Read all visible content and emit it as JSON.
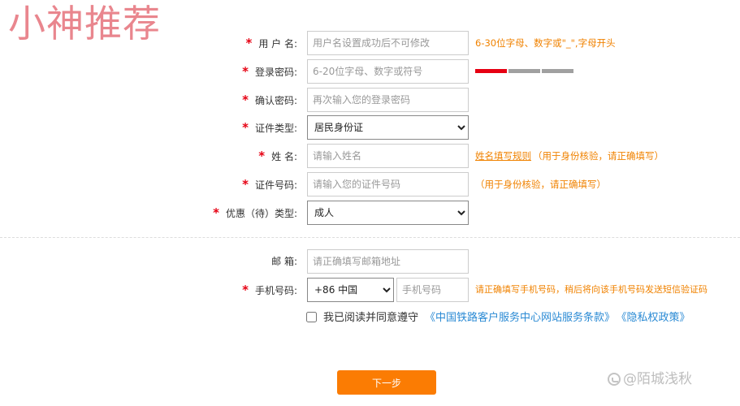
{
  "watermark_top": "小神推荐",
  "watermark_bottom": "@陌城浅秋",
  "colors": {
    "required_star": "#e60012",
    "hint": "#f08200",
    "link_blue": "#2a8ad4",
    "button": "#fb7c03"
  },
  "form": {
    "username": {
      "label": "用 户 名:",
      "placeholder": "用户名设置成功后不可修改",
      "hint": "6-30位字母、数字或\"_\",字母开头"
    },
    "password": {
      "label": "登录密码:",
      "placeholder": "6-20位字母、数字或符号",
      "strength_level": 1,
      "strength_total": 3
    },
    "confirm_password": {
      "label": "确认密码:",
      "placeholder": "再次输入您的登录密码"
    },
    "id_type": {
      "label": "证件类型:",
      "selected": "居民身份证"
    },
    "name": {
      "label": "姓 名:",
      "placeholder": "请输入姓名",
      "hint_link": "姓名填写规则",
      "hint_note": "（用于身份核验，请正确填写）"
    },
    "id_number": {
      "label": "证件号码:",
      "placeholder": "请输入您的证件号码",
      "hint": "（用于身份核验，请正确填写）"
    },
    "passenger_type": {
      "label": "优惠（待）类型:",
      "selected": "成人"
    },
    "email": {
      "label": "邮 箱:",
      "placeholder": "请正确填写邮箱地址"
    },
    "phone": {
      "label": "手机号码:",
      "country_code": "+86 中国",
      "placeholder": "手机号码",
      "hint": "请正确填写手机号码，稍后将向该手机号码发送短信验证码"
    }
  },
  "agreement": {
    "text": "我已阅读并同意遵守",
    "terms_link": "《中国铁路客户服务中心网站服务条款》",
    "privacy_link": "《隐私权政策》"
  },
  "next_button": "下一步"
}
